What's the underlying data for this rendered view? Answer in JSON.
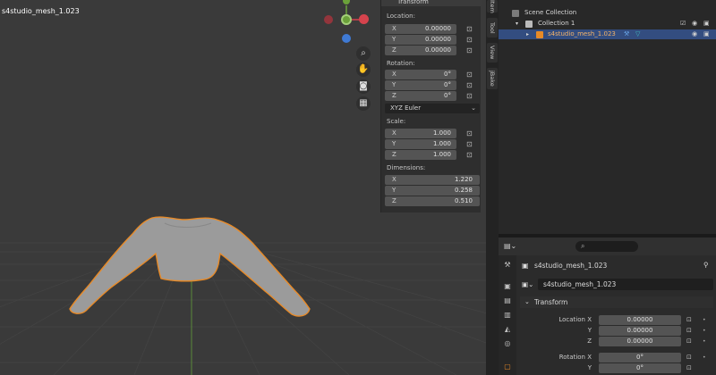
{
  "viewport": {
    "object_name": "s4studio_mesh_1.023",
    "gizmo_colors": {
      "x": "#d5434d",
      "y": "#6ba13a",
      "z": "#3f7ad4"
    }
  },
  "npanel": {
    "header": "Transform",
    "location_label": "Location:",
    "location": [
      {
        "axis": "X",
        "value": "0.00000"
      },
      {
        "axis": "Y",
        "value": "0.00000"
      },
      {
        "axis": "Z",
        "value": "0.00000"
      }
    ],
    "rotation_label": "Rotation:",
    "rotation": [
      {
        "axis": "X",
        "value": "0°"
      },
      {
        "axis": "Y",
        "value": "0°"
      },
      {
        "axis": "Z",
        "value": "0°"
      }
    ],
    "rotation_mode": "XYZ Euler",
    "scale_label": "Scale:",
    "scale": [
      {
        "axis": "X",
        "value": "1.000"
      },
      {
        "axis": "Y",
        "value": "1.000"
      },
      {
        "axis": "Z",
        "value": "1.000"
      }
    ],
    "dimensions_label": "Dimensions:",
    "dimensions": [
      {
        "axis": "X",
        "value": "1.220"
      },
      {
        "axis": "Y",
        "value": "0.258"
      },
      {
        "axis": "Z",
        "value": "0.510"
      }
    ]
  },
  "side_tabs": [
    "Item",
    "Tool",
    "View",
    "jBake"
  ],
  "outliner": {
    "scene_collection": "Scene Collection",
    "collection": "Collection 1",
    "object": "s4studio_mesh_1.023"
  },
  "properties": {
    "object_name": "s4studio_mesh_1.023",
    "data_name": "s4studio_mesh_1.023",
    "section": "Transform",
    "rows": [
      {
        "label": "Location X",
        "value": "0.00000"
      },
      {
        "label": "Y",
        "value": "0.00000"
      },
      {
        "label": "Z",
        "value": "0.00000"
      },
      {
        "label": "Rotation X",
        "value": "0°"
      },
      {
        "label": "Y",
        "value": "0°"
      }
    ]
  }
}
